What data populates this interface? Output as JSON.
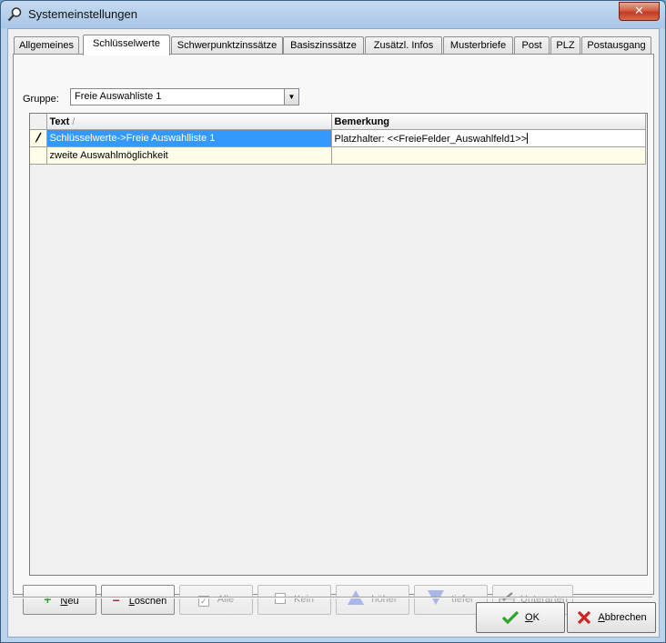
{
  "window": {
    "title": "Systemeinstellungen",
    "close_glyph": "✕"
  },
  "tabs": [
    {
      "label": "Allgemeines"
    },
    {
      "label": "Schlüsselwerte"
    },
    {
      "label": "Schwerpunktzinssätze"
    },
    {
      "label": "Basiszinssätze"
    },
    {
      "label": "Zusätzl. Infos"
    },
    {
      "label": "Musterbriefe"
    },
    {
      "label": "Post"
    },
    {
      "label": "PLZ"
    },
    {
      "label": "Postausgang"
    }
  ],
  "active_tab": "Schlüsselwerte",
  "group": {
    "label": "Gruppe:",
    "value": "Freie Auswahliste 1"
  },
  "grid": {
    "columns": [
      {
        "label": "Text",
        "sort_indicator": "/"
      },
      {
        "label": "Bemerkung"
      }
    ],
    "rows": [
      {
        "text": "Schlüsselwerte->Freie Auswahlliste 1",
        "bemerkung": "Platzhalter: <<FreieFelder_Auswahlfeld1>>",
        "indicator": "pencil-icon",
        "selected": true
      },
      {
        "text": "zweite Auswahlmöglichkeit",
        "bemerkung": ""
      }
    ]
  },
  "buttons": {
    "neu": {
      "prefix": "",
      "hotkey": "N",
      "rest": "eu",
      "icon": "plus-icon",
      "enabled": true
    },
    "loeschen": {
      "prefix": "",
      "hotkey": "L",
      "rest": "öschen",
      "icon": "minus-icon",
      "enabled": true
    },
    "alle": {
      "label": "Alle",
      "icon": "checked-box-icon",
      "enabled": false
    },
    "kein": {
      "label": "Kein",
      "icon": "empty-box-icon",
      "enabled": false
    },
    "hoeher": {
      "label": "höher",
      "icon": "arrow-up-icon",
      "enabled": false
    },
    "tiefer": {
      "label": "tiefer",
      "icon": "arrow-down-icon",
      "enabled": false
    },
    "unterarten": {
      "hotkey": "U",
      "rest": "nterarten",
      "icon": "pen-tool-icon",
      "enabled": false
    }
  },
  "dialog_buttons": {
    "ok": {
      "hotkey": "O",
      "rest": "K",
      "icon": "checkmark-icon"
    },
    "abbrechen": {
      "hotkey": "A",
      "rest": "bbrechen",
      "icon": "red-x-icon"
    }
  },
  "colors": {
    "selection": "#3399ff",
    "row_background": "#fffde7",
    "ok_green": "#2aa52a",
    "cancel_red": "#d32222",
    "arrow_blue": "#a9b6ea"
  }
}
